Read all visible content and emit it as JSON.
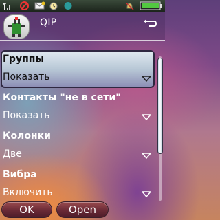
{
  "app": {
    "title": "QIP"
  },
  "status_bar": {
    "icons": [
      "signal-icon",
      "no-sim-icon",
      "message-icon",
      "alarm-icon",
      "bluetooth-icon",
      "bell-icon",
      "battery-icon"
    ]
  },
  "list": {
    "items": [
      {
        "title": "Группы",
        "value": "Показать",
        "selected": true
      },
      {
        "title": "Контакты \"не в сети\"",
        "value": "Показать",
        "selected": false
      },
      {
        "title": "Колонки",
        "value": "Две",
        "selected": false
      },
      {
        "title": "Вибра",
        "value": "Включить",
        "selected": false
      }
    ]
  },
  "softkeys": {
    "left": "OK",
    "right": "Open"
  },
  "colors": {
    "selection_top": "#dfe8ef",
    "selection_bottom": "#8d8fb6",
    "softkey": "#6a2a36"
  }
}
